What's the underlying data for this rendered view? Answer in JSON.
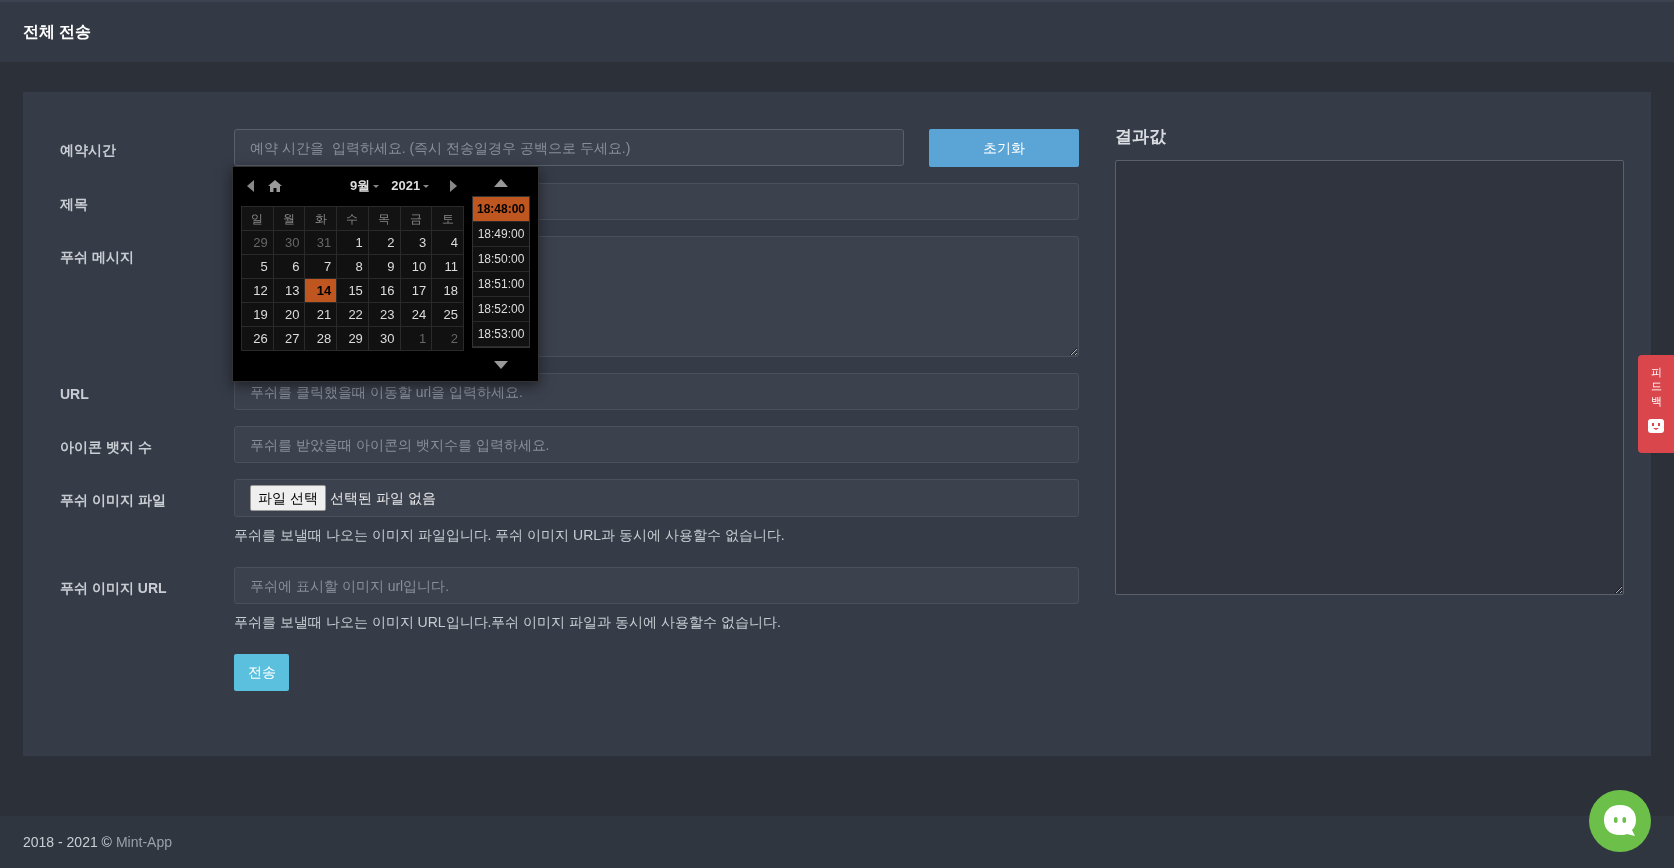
{
  "header": {
    "title": "전체 전송"
  },
  "form": {
    "schedule": {
      "label": "예약시간",
      "placeholder": "예약 시간을  입력하세요. (즉시 전송일경우 공백으로 두세요.)"
    },
    "reset_button": "초기화",
    "fields": [
      {
        "kind": "input",
        "label": "제목"
      },
      {
        "kind": "textarea",
        "label": "푸쉬 메시지"
      },
      {
        "kind": "input",
        "label": "URL",
        "placeholder": "푸쉬를 클릭했을때 이동할 url을 입력하세요."
      },
      {
        "kind": "input",
        "label": "아이콘 뱃지 수",
        "placeholder": "푸쉬를 받았을때 아이콘의 뱃지수를 입력하세요."
      },
      {
        "kind": "file",
        "label": "푸쉬 이미지 파일",
        "button": "파일 선택",
        "status": "선택된 파일 없음",
        "help": "푸쉬를 보낼때 나오는 이미지 파일입니다. 푸쉬 이미지 URL과 동시에 사용할수 없습니다."
      },
      {
        "kind": "input",
        "label": "푸쉬 이미지 URL",
        "placeholder": "푸쉬에 표시할 이미지 url입니다.",
        "help": "푸쉬를 보낼때 나오는 이미지 URL입니다.푸쉬 이미지 파일과 동시에 사용할수 없습니다."
      }
    ],
    "send_button": "전송"
  },
  "datepicker": {
    "month": "9월",
    "year": "2021",
    "weekdays": [
      "일",
      "월",
      "화",
      "수",
      "목",
      "금",
      "토"
    ],
    "days": [
      {
        "label": "29",
        "muted": true,
        "selected": false
      },
      {
        "label": "30",
        "muted": true,
        "selected": false
      },
      {
        "label": "31",
        "muted": true,
        "selected": false
      },
      {
        "label": "1",
        "muted": false,
        "selected": false
      },
      {
        "label": "2",
        "muted": false,
        "selected": false
      },
      {
        "label": "3",
        "muted": false,
        "selected": false
      },
      {
        "label": "4",
        "muted": false,
        "selected": false
      },
      {
        "label": "5",
        "muted": false,
        "selected": false
      },
      {
        "label": "6",
        "muted": false,
        "selected": false
      },
      {
        "label": "7",
        "muted": false,
        "selected": false
      },
      {
        "label": "8",
        "muted": false,
        "selected": false
      },
      {
        "label": "9",
        "muted": false,
        "selected": false
      },
      {
        "label": "10",
        "muted": false,
        "selected": false
      },
      {
        "label": "11",
        "muted": false,
        "selected": false
      },
      {
        "label": "12",
        "muted": false,
        "selected": false
      },
      {
        "label": "13",
        "muted": false,
        "selected": false
      },
      {
        "label": "14",
        "muted": false,
        "selected": true
      },
      {
        "label": "15",
        "muted": false,
        "selected": false
      },
      {
        "label": "16",
        "muted": false,
        "selected": false
      },
      {
        "label": "17",
        "muted": false,
        "selected": false
      },
      {
        "label": "18",
        "muted": false,
        "selected": false
      },
      {
        "label": "19",
        "muted": false,
        "selected": false
      },
      {
        "label": "20",
        "muted": false,
        "selected": false
      },
      {
        "label": "21",
        "muted": false,
        "selected": false
      },
      {
        "label": "22",
        "muted": false,
        "selected": false
      },
      {
        "label": "23",
        "muted": false,
        "selected": false
      },
      {
        "label": "24",
        "muted": false,
        "selected": false
      },
      {
        "label": "25",
        "muted": false,
        "selected": false
      },
      {
        "label": "26",
        "muted": false,
        "selected": false
      },
      {
        "label": "27",
        "muted": false,
        "selected": false
      },
      {
        "label": "28",
        "muted": false,
        "selected": false
      },
      {
        "label": "29",
        "muted": false,
        "selected": false
      },
      {
        "label": "30",
        "muted": false,
        "selected": false
      },
      {
        "label": "1",
        "muted": true,
        "selected": false
      },
      {
        "label": "2",
        "muted": true,
        "selected": false
      }
    ],
    "times": [
      {
        "label": "18:48:00",
        "selected": true
      },
      {
        "label": "18:49:00",
        "selected": false
      },
      {
        "label": "18:50:00",
        "selected": false
      },
      {
        "label": "18:51:00",
        "selected": false
      },
      {
        "label": "18:52:00",
        "selected": false
      },
      {
        "label": "18:53:00",
        "selected": false
      }
    ]
  },
  "result": {
    "label": "결과값"
  },
  "feedback_tab": {
    "label": "피드백"
  },
  "footer": {
    "text": "2018 - 2021 ©",
    "link": "Mint-App"
  }
}
